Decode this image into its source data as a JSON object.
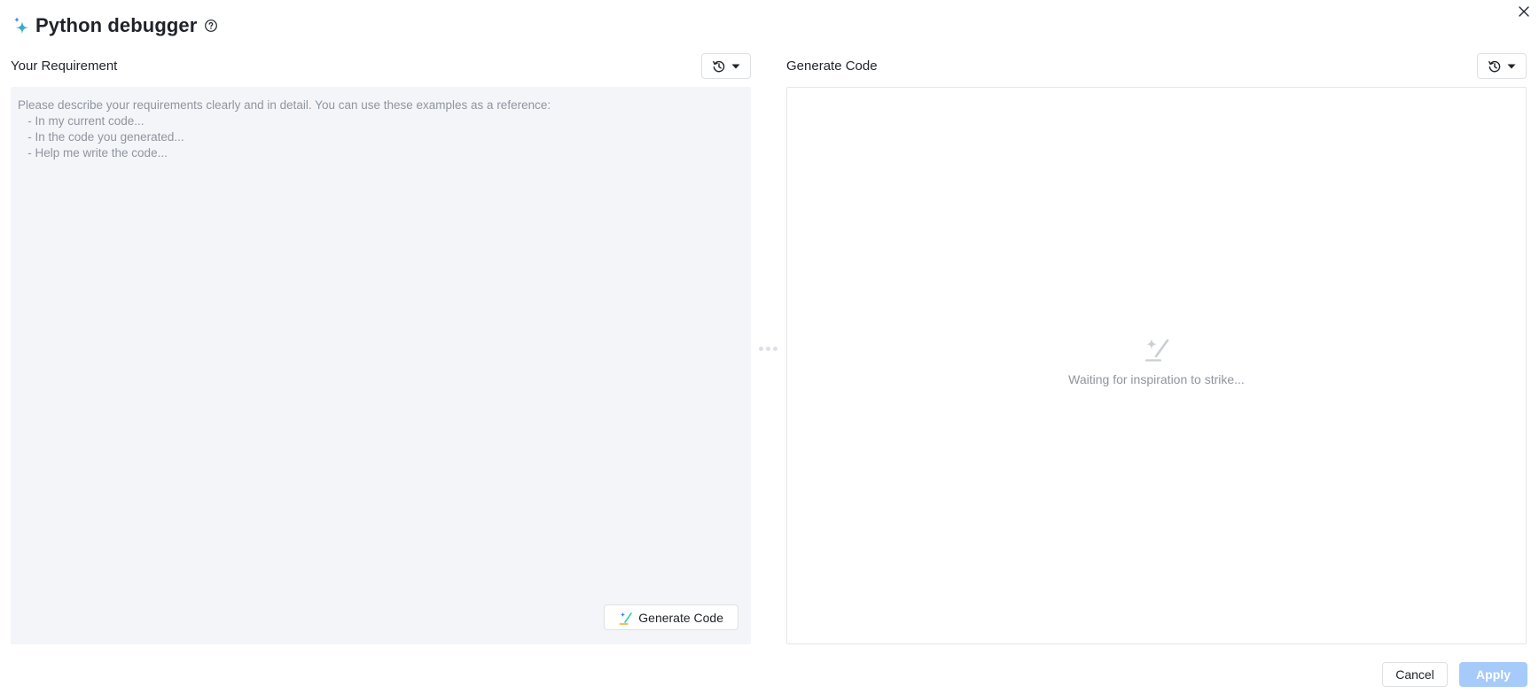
{
  "dialog": {
    "title": "Python debugger",
    "icons": {
      "title": "sparkle-icon",
      "help": "help-circle-icon",
      "close": "close-icon"
    }
  },
  "left_panel": {
    "label": "Your Requirement",
    "history_icon": "history-icon",
    "dropdown_icon": "caret-down-icon",
    "input_value": "",
    "input_placeholder": "Please describe your requirements clearly and in detail. You can use these examples as a reference:\n   - In my current code...\n   - In the code you generated...\n   - Help me write the code...",
    "generate_button_label": "Generate Code",
    "generate_button_icon": "magic-wand-icon"
  },
  "right_panel": {
    "label": "Generate Code",
    "history_icon": "history-icon",
    "dropdown_icon": "caret-down-icon",
    "empty_icon": "magic-wand-icon",
    "empty_text": "Waiting for inspiration to strike..."
  },
  "footer": {
    "cancel_label": "Cancel",
    "apply_label": "Apply"
  },
  "colors": {
    "accent_disabled": "#a6cbfa",
    "input_background": "#f4f5f9",
    "muted_text": "#8f959e",
    "border": "#dee0e3",
    "sparkle_blue": "#3b82f6",
    "sparkle_green": "#34d399"
  }
}
